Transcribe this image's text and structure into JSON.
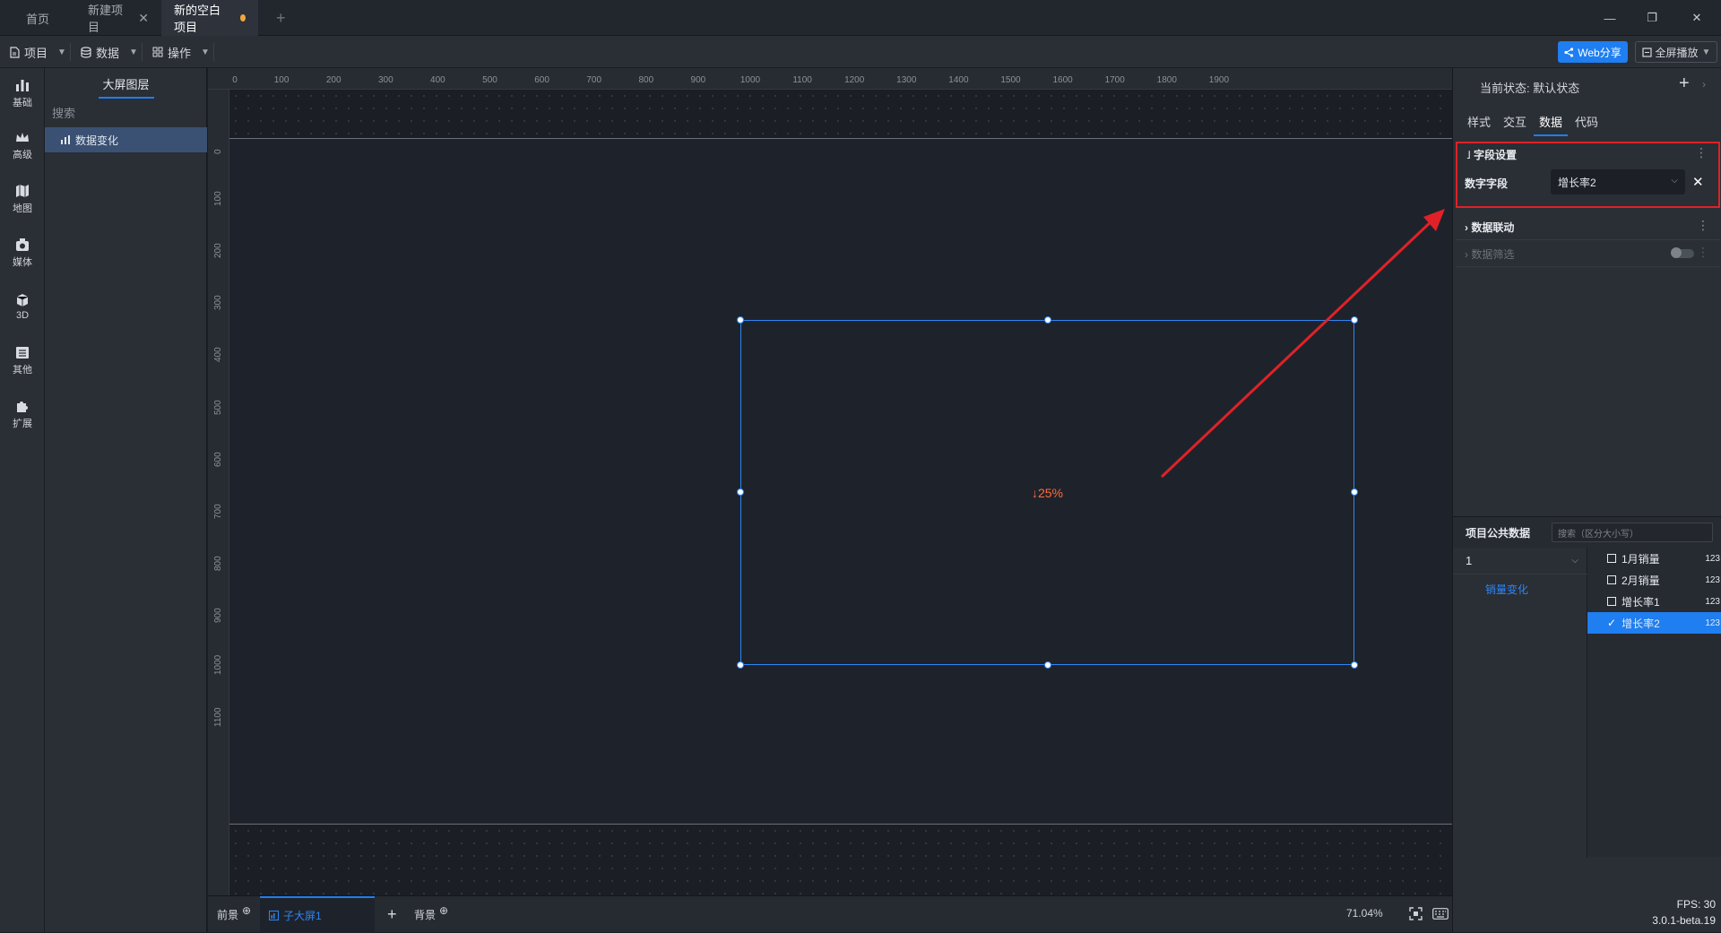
{
  "tabs": [
    {
      "label": "首页"
    },
    {
      "label": "新建项目",
      "closable": true
    },
    {
      "label": "新的空白项目",
      "active": true,
      "unsaved": true
    }
  ],
  "window_controls": {
    "add": "+",
    "minimize": "—",
    "restore": "❐",
    "close": "✕"
  },
  "menubar": {
    "project": "项目",
    "data": "数据",
    "operate": "操作",
    "web_share": "Web分享",
    "fullscreen": "全屏播放"
  },
  "icon_sidebar": [
    {
      "label": "基础",
      "icon": "bar-chart-icon"
    },
    {
      "label": "高级",
      "icon": "crown-icon"
    },
    {
      "label": "地图",
      "icon": "map-icon"
    },
    {
      "label": "媒体",
      "icon": "media-icon"
    },
    {
      "label": "3D",
      "icon": "cube-icon"
    },
    {
      "label": "其他",
      "icon": "list-icon"
    },
    {
      "label": "扩展",
      "icon": "puzzle-icon"
    }
  ],
  "layer_panel": {
    "title": "大屏图层",
    "search_placeholder": "搜索",
    "items": [
      {
        "label": "数据变化",
        "selected": true
      }
    ]
  },
  "ruler": {
    "h_labels": [
      "0",
      "100",
      "200",
      "300",
      "400",
      "500",
      "600",
      "700",
      "800",
      "900",
      "1000",
      "1100",
      "1200",
      "1300",
      "1400",
      "1500",
      "1600",
      "1700",
      "1800",
      "1900"
    ],
    "v_labels": [
      "0",
      "100",
      "200",
      "300",
      "400",
      "500",
      "600",
      "700",
      "800",
      "900",
      "1000",
      "1100"
    ]
  },
  "widget": {
    "value_text": "↓25%",
    "value_color": "#ff6a3a"
  },
  "bottom_bar": {
    "foreground": "前景",
    "sub_screen": "子大屏1",
    "add": "+",
    "background": "背景",
    "zoom": "71.04%"
  },
  "right_panel": {
    "state_label": "当前状态:",
    "state_value": "默认状态",
    "tabs": [
      {
        "label": "样式"
      },
      {
        "label": "交互"
      },
      {
        "label": "数据",
        "active": true
      },
      {
        "label": "代码"
      }
    ],
    "field_settings": {
      "title": "字段设置",
      "number_field_label": "数字字段",
      "number_field_value": "增长率2"
    },
    "data_linkage": "数据联动",
    "data_filter": "数据筛选",
    "public_data": {
      "title": "项目公共数据",
      "search_placeholder": "搜索（区分大小写）",
      "group": "1",
      "source": "销量变化",
      "fields": [
        {
          "label": "1月销量",
          "type": "123",
          "checked": false
        },
        {
          "label": "2月销量",
          "type": "123",
          "checked": false
        },
        {
          "label": "增长率1",
          "type": "123",
          "checked": false
        },
        {
          "label": "增长率2",
          "type": "123",
          "checked": true
        }
      ]
    }
  },
  "status": {
    "fps": "FPS: 30",
    "version": "3.0.1-beta.19"
  },
  "colors": {
    "accent": "#1f7ef0",
    "highlight_box": "#e02128",
    "arrow": "#e02128"
  }
}
